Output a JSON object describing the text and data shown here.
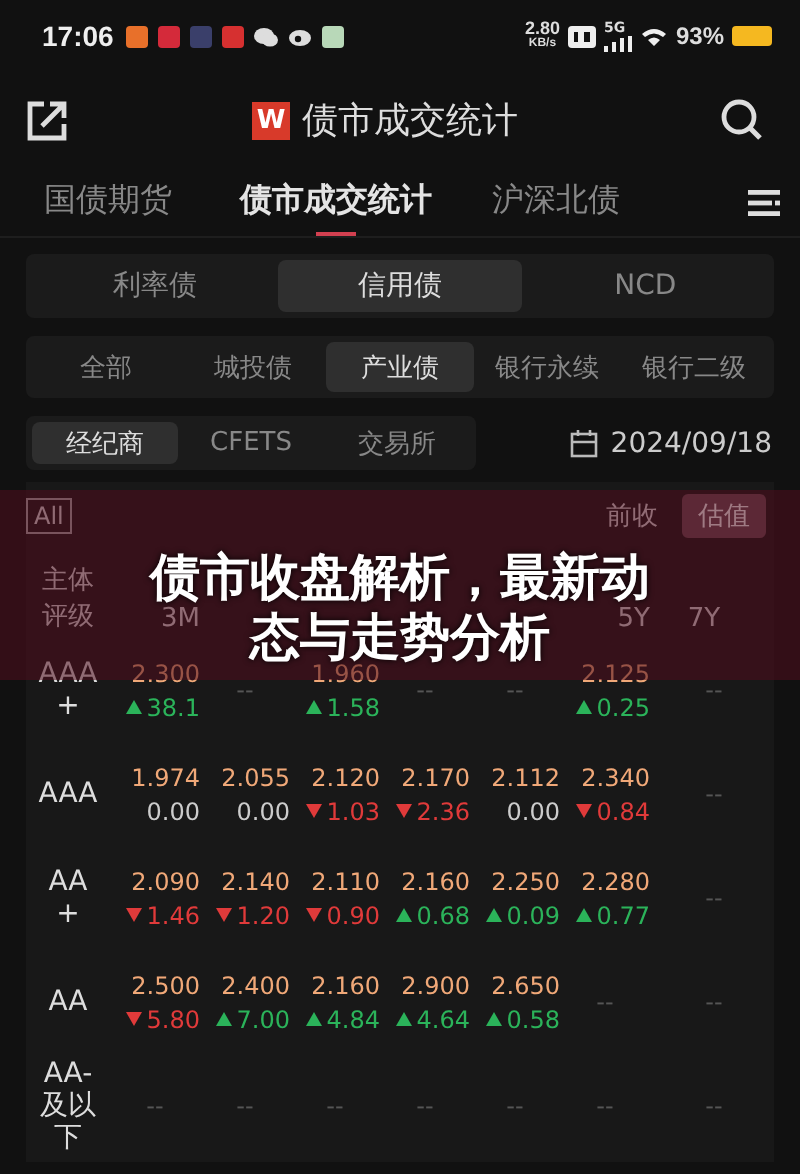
{
  "status_bar": {
    "time": "17:06",
    "speed": "2.80",
    "speed_unit": "KB/s",
    "network": "5G",
    "battery": "93%"
  },
  "header": {
    "title": "债市成交统计",
    "logo": "W"
  },
  "tabs": [
    {
      "label": "国债期货",
      "selected": false
    },
    {
      "label": "债市成交统计",
      "selected": true
    },
    {
      "label": "沪深北债",
      "selected": false
    }
  ],
  "bond_types": [
    {
      "label": "利率债",
      "selected": false
    },
    {
      "label": "信用债",
      "selected": true
    },
    {
      "label": "NCD",
      "selected": false
    }
  ],
  "categories": [
    {
      "label": "全部",
      "selected": false
    },
    {
      "label": "城投债",
      "selected": false
    },
    {
      "label": "产业债",
      "selected": true
    },
    {
      "label": "银行永续",
      "selected": false
    },
    {
      "label": "银行二级",
      "selected": false
    }
  ],
  "sources": [
    {
      "label": "经纪商",
      "selected": true
    },
    {
      "label": "CFETS",
      "selected": false
    },
    {
      "label": "交易所",
      "selected": false
    }
  ],
  "date": "2024/09/18",
  "table": {
    "filter": "All",
    "modes": [
      {
        "label": "前收",
        "selected": false
      },
      {
        "label": "估值",
        "selected": true
      }
    ],
    "rating_header": "主体评级",
    "columns": [
      "3M",
      "",
      "",
      "",
      "",
      "5Y",
      "7Y"
    ],
    "rows": [
      {
        "rating": "AAA+",
        "cells": [
          {
            "value": "2.300",
            "change": "38.1",
            "kind": "up"
          },
          null,
          {
            "value": "1.960",
            "change": "1.58",
            "kind": "up"
          },
          null,
          null,
          {
            "value": "2.125",
            "change": "0.25",
            "kind": "up"
          },
          null
        ]
      },
      {
        "rating": "AAA",
        "cells": [
          {
            "value": "1.974",
            "change": "0.00",
            "kind": "flat"
          },
          {
            "value": "2.055",
            "change": "0.00",
            "kind": "flat"
          },
          {
            "value": "2.120",
            "change": "1.03",
            "kind": "down"
          },
          {
            "value": "2.170",
            "change": "2.36",
            "kind": "down"
          },
          {
            "value": "2.112",
            "change": "0.00",
            "kind": "flat"
          },
          {
            "value": "2.340",
            "change": "0.84",
            "kind": "down"
          },
          null
        ]
      },
      {
        "rating": "AA+",
        "cells": [
          {
            "value": "2.090",
            "change": "1.46",
            "kind": "down"
          },
          {
            "value": "2.140",
            "change": "1.20",
            "kind": "down"
          },
          {
            "value": "2.110",
            "change": "0.90",
            "kind": "down"
          },
          {
            "value": "2.160",
            "change": "0.68",
            "kind": "up"
          },
          {
            "value": "2.250",
            "change": "0.09",
            "kind": "up"
          },
          {
            "value": "2.280",
            "change": "0.77",
            "kind": "up"
          },
          null
        ]
      },
      {
        "rating": "AA",
        "cells": [
          {
            "value": "2.500",
            "change": "5.80",
            "kind": "down"
          },
          {
            "value": "2.400",
            "change": "7.00",
            "kind": "up"
          },
          {
            "value": "2.160",
            "change": "4.84",
            "kind": "up"
          },
          {
            "value": "2.900",
            "change": "4.64",
            "kind": "up"
          },
          {
            "value": "2.650",
            "change": "0.58",
            "kind": "up"
          },
          null,
          null
        ]
      },
      {
        "rating": "AA-及以下",
        "cells": [
          null,
          null,
          null,
          null,
          null,
          null,
          null
        ]
      }
    ],
    "empty": "--"
  },
  "banner": {
    "title_lines": [
      "债市收盘解析，最新动",
      "态与走势分析"
    ]
  }
}
